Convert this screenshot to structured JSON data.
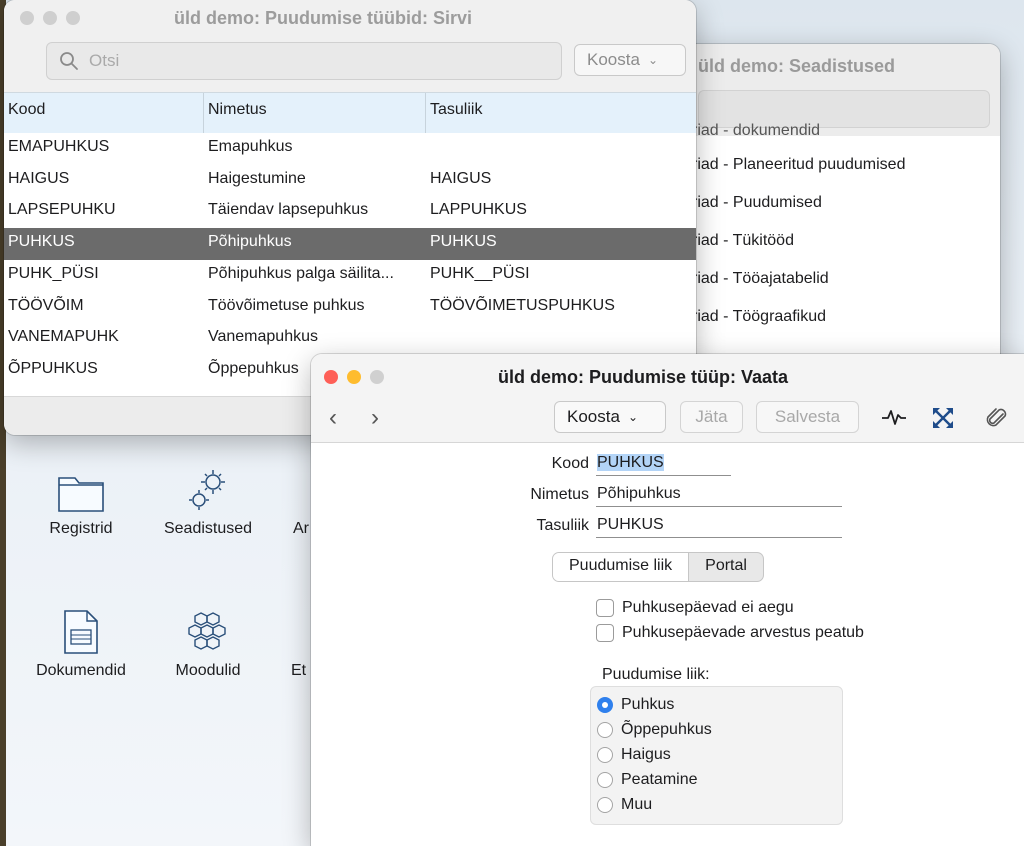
{
  "settings_window": {
    "title": "üld demo: Seadistused",
    "items": [
      "riad - dokumendid",
      "riad - Planeeritud puudumised",
      "riad - Puudumised",
      "riad - Tükitööd",
      "riad - Tööajatabelid",
      "riad - Töögraafikud"
    ]
  },
  "desktop": {
    "icons": [
      {
        "label": "Registrid",
        "icon": "folder-icon"
      },
      {
        "label": "Seadistused",
        "icon": "gears-icon"
      },
      {
        "label": "Ar",
        "icon": ""
      },
      {
        "label": "Dokumendid",
        "icon": "document-icon"
      },
      {
        "label": "Moodulid",
        "icon": "hexagon-cluster-icon"
      },
      {
        "label": "Et",
        "icon": ""
      }
    ]
  },
  "browse_window": {
    "title": "üld demo: Puudumise tüübid: Sirvi",
    "search_placeholder": "Otsi",
    "koosta_label": "Koosta",
    "columns": [
      "Kood",
      "Nimetus",
      "Tasuliik"
    ],
    "rows": [
      {
        "kood": "EMAPUHKUS",
        "nimetus": "Emapuhkus",
        "tasuliik": ""
      },
      {
        "kood": "HAIGUS",
        "nimetus": "Haigestumine",
        "tasuliik": "HAIGUS"
      },
      {
        "kood": "LAPSEPUHKU",
        "nimetus": "Täiendav lapsepuhkus",
        "tasuliik": "LAPPUHKUS"
      },
      {
        "kood": "PUHKUS",
        "nimetus": "Põhipuhkus",
        "tasuliik": "PUHKUS"
      },
      {
        "kood": "PUHK_PÜSI",
        "nimetus": "Põhipuhkus palga säilita...",
        "tasuliik": "PUHK__PÜSI"
      },
      {
        "kood": "TÖÖVÕIM",
        "nimetus": "Töövõimetuse puhkus",
        "tasuliik": "TÖÖVÕIMETUSPUHKUS"
      },
      {
        "kood": "VANEMAPUHK",
        "nimetus": "Vanemapuhkus",
        "tasuliik": ""
      },
      {
        "kood": "ÕPPUHKUS",
        "nimetus": "Õppepuhkus",
        "tasuliik": ""
      }
    ],
    "selected_row": "PUHKUS"
  },
  "record_window": {
    "title": "üld demo: Puudumise tüüp: Vaata",
    "toolbar": {
      "koosta_label": "Koosta",
      "jata_label": "Jäta",
      "salvesta_label": "Salvesta"
    },
    "fields": {
      "kood_label": "Kood",
      "kood_value": "PUHKUS",
      "nimetus_label": "Nimetus",
      "nimetus_value": "Põhipuhkus",
      "tasuliik_label": "Tasuliik",
      "tasuliik_value": "PUHKUS"
    },
    "tabs": [
      "Puudumise liik",
      "Portal"
    ],
    "active_tab": "Puudumise liik",
    "checkboxes": [
      {
        "label": "Puhkusepäevad ei aegu",
        "checked": false
      },
      {
        "label": "Puhkusepäevade arvestus peatub",
        "checked": false
      }
    ],
    "radio_group_label": "Puudumise liik:",
    "radio_options": [
      "Puhkus",
      "Õppepuhkus",
      "Haigus",
      "Peatamine",
      "Muu"
    ],
    "radio_selected": "Puhkus"
  },
  "colors": {
    "close": "#fe5f57",
    "minimize": "#febc2e",
    "zoom_inactive": "#d0d0d0",
    "selection_row": "#6b6b6b",
    "header_bg": "#e4f1fb",
    "radio_accent": "#2f80ed",
    "field_highlight": "#b3d4f7"
  }
}
